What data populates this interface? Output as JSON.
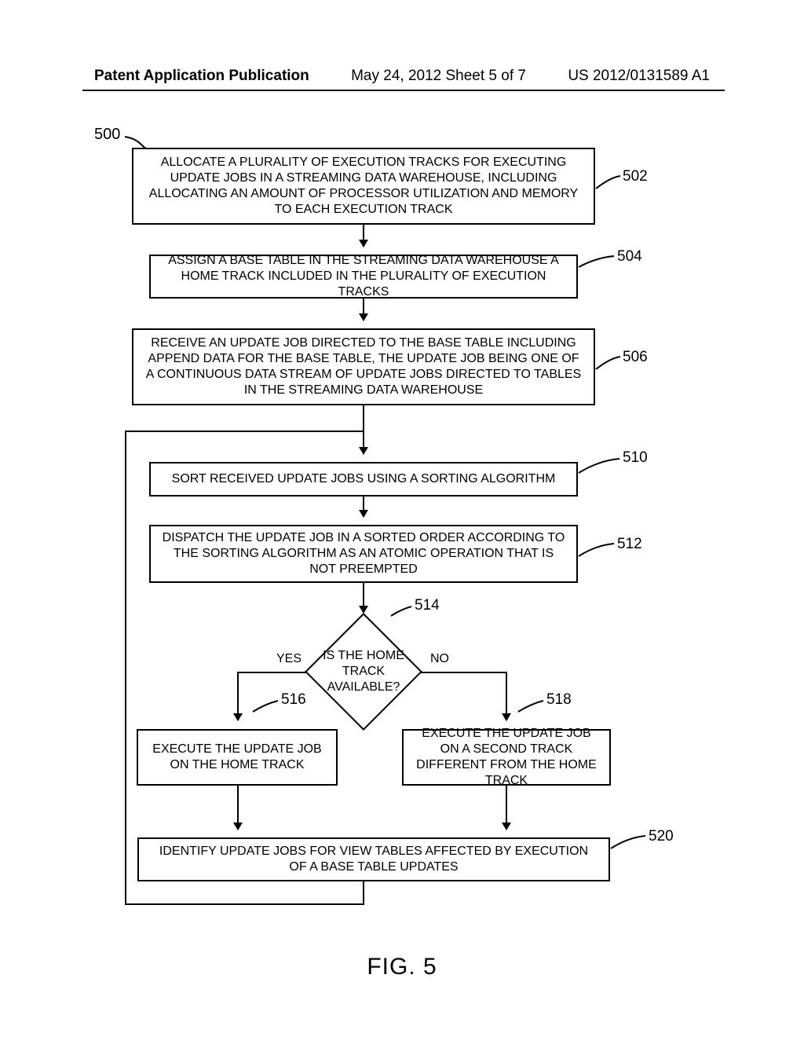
{
  "header": {
    "left": "Patent Application Publication",
    "mid": "May 24, 2012  Sheet 5 of 7",
    "right": "US 2012/0131589 A1"
  },
  "figure_label": "FIG. 5",
  "ref500": "500",
  "refs": {
    "r502": "502",
    "r504": "504",
    "r506": "506",
    "r510": "510",
    "r512": "512",
    "r514": "514",
    "r516": "516",
    "r518": "518",
    "r520": "520"
  },
  "boxes": {
    "b502": "ALLOCATE A PLURALITY OF EXECUTION TRACKS FOR EXECUTING UPDATE JOBS IN A STREAMING DATA WAREHOUSE, INCLUDING ALLOCATING AN AMOUNT OF PROCESSOR UTILIZATION AND MEMORY TO EACH EXECUTION TRACK",
    "b504": "ASSIGN A BASE TABLE IN THE STREAMING DATA WAREHOUSE A HOME TRACK INCLUDED IN THE PLURALITY OF EXECUTION TRACKS",
    "b506": "RECEIVE AN UPDATE JOB DIRECTED TO THE BASE TABLE INCLUDING APPEND DATA FOR THE BASE TABLE, THE UPDATE JOB BEING ONE OF A CONTINUOUS DATA STREAM OF UPDATE JOBS DIRECTED TO TABLES IN THE STREAMING DATA WAREHOUSE",
    "b510": "SORT RECEIVED UPDATE JOBS USING A SORTING ALGORITHM",
    "b512": "DISPATCH THE UPDATE JOB IN A SORTED ORDER ACCORDING TO THE SORTING ALGORITHM AS AN ATOMIC OPERATION THAT IS NOT PREEMPTED",
    "b516": "EXECUTE THE UPDATE JOB ON THE HOME TRACK",
    "b518": "EXECUTE THE UPDATE JOB ON A SECOND TRACK DIFFERENT FROM THE HOME TRACK",
    "b520": "IDENTIFY UPDATE JOBS FOR VIEW TABLES AFFECTED BY EXECUTION OF A BASE TABLE UPDATES"
  },
  "decision": {
    "text": "IS THE HOME TRACK AVAILABLE?",
    "yes": "YES",
    "no": "NO"
  }
}
